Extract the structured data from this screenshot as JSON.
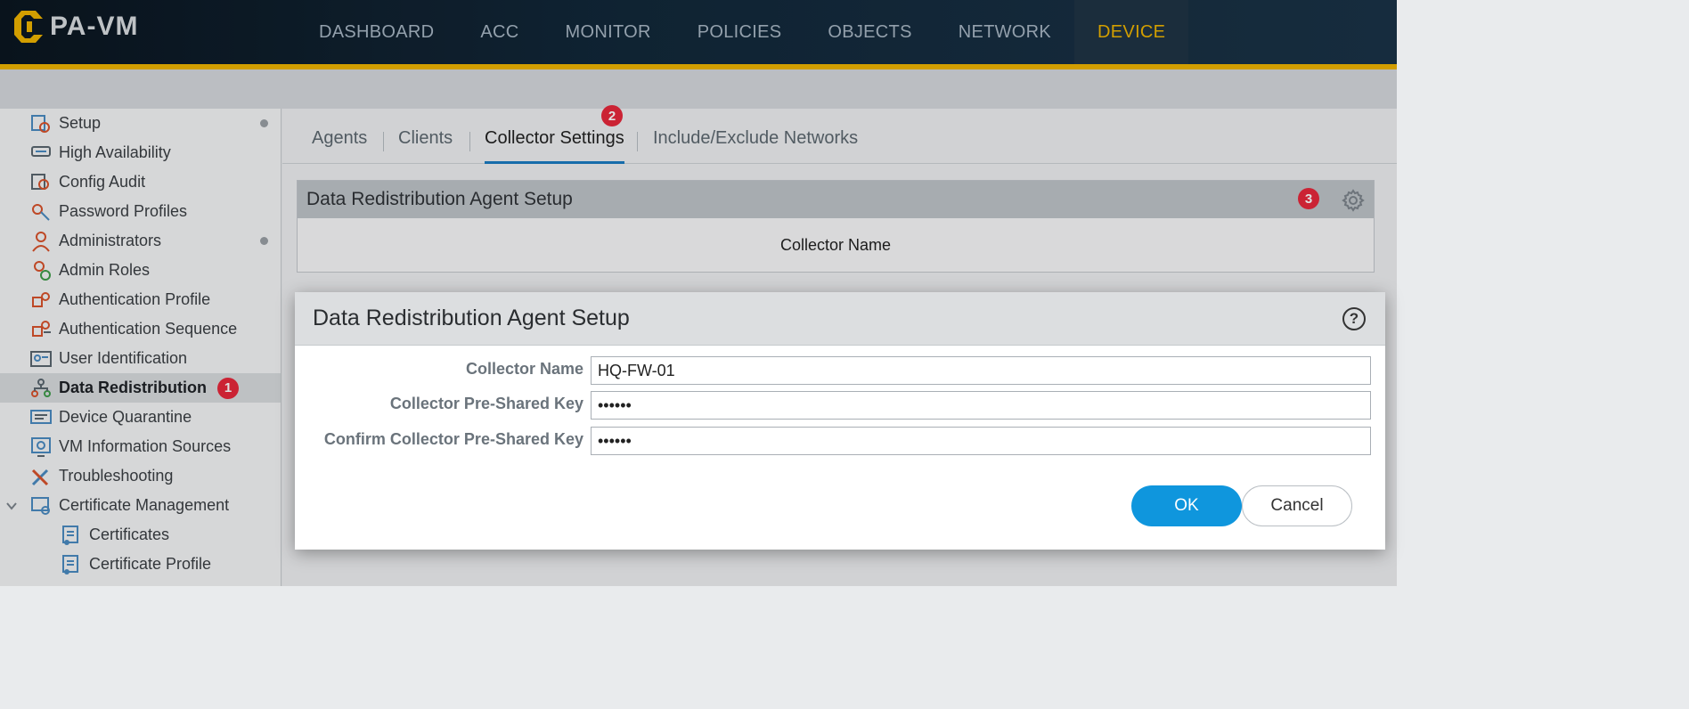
{
  "app": {
    "title": "PA-VM",
    "colors": {
      "accent": "#f0b400",
      "primary_button": "#0f96dd",
      "badge": "#e8283c"
    }
  },
  "nav": [
    {
      "label": "DASHBOARD",
      "active": false
    },
    {
      "label": "ACC",
      "active": false
    },
    {
      "label": "MONITOR",
      "active": false
    },
    {
      "label": "POLICIES",
      "active": false
    },
    {
      "label": "OBJECTS",
      "active": false
    },
    {
      "label": "NETWORK",
      "active": false
    },
    {
      "label": "DEVICE",
      "active": true
    }
  ],
  "sidebar": {
    "items": [
      {
        "label": "Setup",
        "icon": "setup-icon",
        "dot": true
      },
      {
        "label": "High Availability",
        "icon": "high-availability-icon"
      },
      {
        "label": "Config Audit",
        "icon": "config-audit-icon"
      },
      {
        "label": "Password Profiles",
        "icon": "password-profiles-icon"
      },
      {
        "label": "Administrators",
        "icon": "administrators-icon",
        "dot": true
      },
      {
        "label": "Admin Roles",
        "icon": "admin-roles-icon"
      },
      {
        "label": "Authentication Profile",
        "icon": "authentication-profile-icon"
      },
      {
        "label": "Authentication Sequence",
        "icon": "authentication-sequence-icon"
      },
      {
        "label": "User Identification",
        "icon": "user-identification-icon"
      },
      {
        "label": "Data Redistribution",
        "icon": "data-redistribution-icon",
        "active": true,
        "badge": "1"
      },
      {
        "label": "Device Quarantine",
        "icon": "device-quarantine-icon"
      },
      {
        "label": "VM Information Sources",
        "icon": "vm-information-sources-icon"
      },
      {
        "label": "Troubleshooting",
        "icon": "troubleshooting-icon"
      },
      {
        "label": "Certificate Management",
        "icon": "certificate-management-icon",
        "expanded": true
      },
      {
        "label": "Certificates",
        "icon": "certificate-icon",
        "sub": true
      },
      {
        "label": "Certificate Profile",
        "icon": "certificate-icon",
        "sub": true
      }
    ]
  },
  "tabs": {
    "items": [
      "Agents",
      "Clients",
      "Collector Settings",
      "Include/Exclude Networks"
    ],
    "active": "Collector Settings",
    "badge": "2"
  },
  "panel": {
    "title": "Data Redistribution Agent Setup",
    "badge": "3",
    "column": "Collector Name"
  },
  "dialog": {
    "title": "Data Redistribution Agent Setup",
    "help": "?",
    "fields": {
      "collector_name": {
        "label": "Collector Name",
        "value": "HQ-FW-01"
      },
      "psk": {
        "label": "Collector Pre-Shared Key",
        "value": "••••••"
      },
      "confirm_psk": {
        "label": "Confirm Collector Pre-Shared Key",
        "value": "••••••"
      }
    },
    "ok": "OK",
    "cancel": "Cancel"
  }
}
